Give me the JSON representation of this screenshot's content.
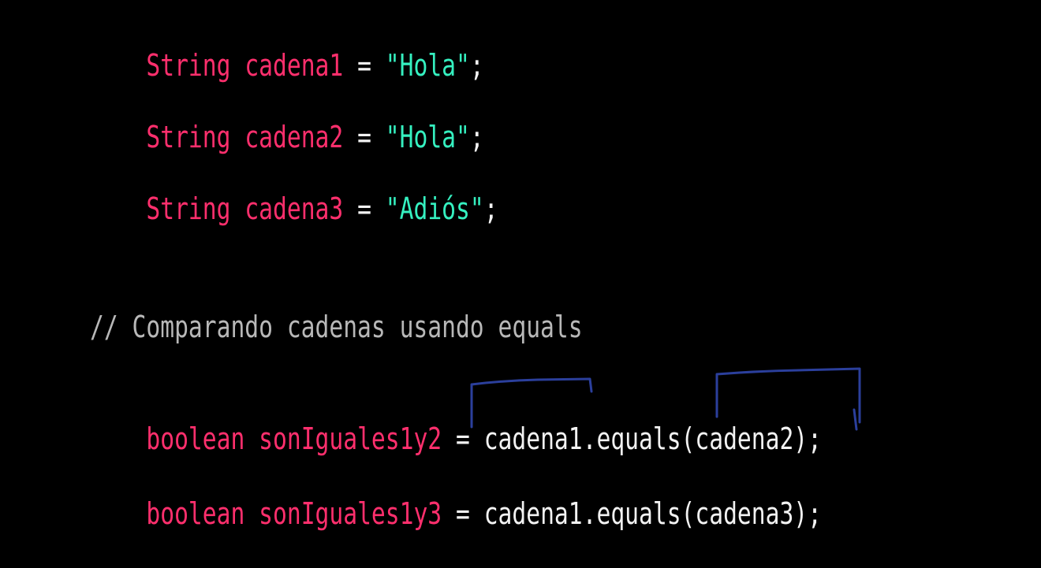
{
  "code_lines": [
    {
      "type": "String",
      "name": "cadena1",
      "op": "=",
      "value": "\"Hola\"",
      "end": ";"
    },
    {
      "type": "String",
      "name": "cadena2",
      "op": "=",
      "value": "\"Hola\"",
      "end": ";"
    },
    {
      "type": "String",
      "name": "cadena3",
      "op": "=",
      "value": "\"Adiós\"",
      "end": ";"
    },
    {
      "comment": "// Comparando cadenas usando equals"
    },
    {
      "type": "boolean",
      "name": "sonIguales1y2",
      "op": "=",
      "call": "cadena1.equals(cadena2)",
      "end": ";"
    },
    {
      "type": "boolean",
      "name": "sonIguales1y3",
      "op": "=",
      "call": "cadena1.equals(cadena3)",
      "end": ";"
    }
  ],
  "colors": {
    "background": "#000000",
    "keyword": "#ff2f6d",
    "string": "#35f0c0",
    "text": "#f2f2f2",
    "comment": "#b8b8b8",
    "annotation": "#2b3f9c"
  }
}
